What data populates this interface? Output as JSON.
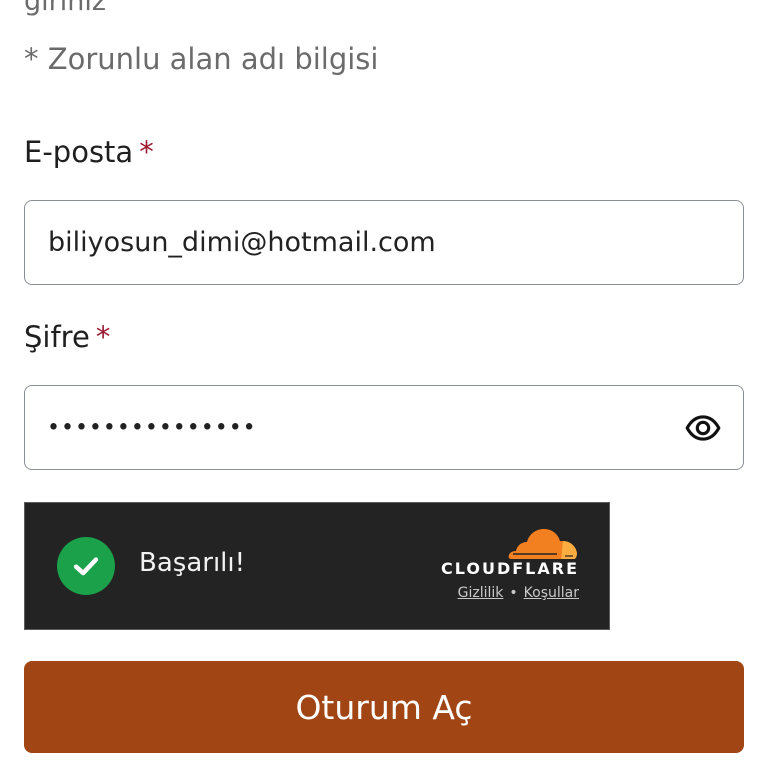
{
  "intro": {
    "partial_line": "giriniz",
    "required_note": "* Zorunlu alan adı bilgisi"
  },
  "email_field": {
    "label": "E-posta",
    "required_mark": "*",
    "value": "biliyosun_dimi@hotmail.com"
  },
  "password_field": {
    "label": "Şifre",
    "required_mark": "*",
    "masked_value": "•••••••••••••••",
    "toggle_icon": "eye-icon"
  },
  "captcha": {
    "status_text": "Başarılı!",
    "status_icon": "check-circle-icon",
    "brand": "CLOUDFLARE",
    "privacy_link": "Gizlilik",
    "separator": "•",
    "terms_link": "Koşullar",
    "colors": {
      "background": "#232323",
      "success": "#1aa14a",
      "cloud_orange": "#f38020",
      "cloud_light": "#fbad41"
    }
  },
  "submit": {
    "label": "Oturum Aç",
    "color": "#a14515"
  }
}
